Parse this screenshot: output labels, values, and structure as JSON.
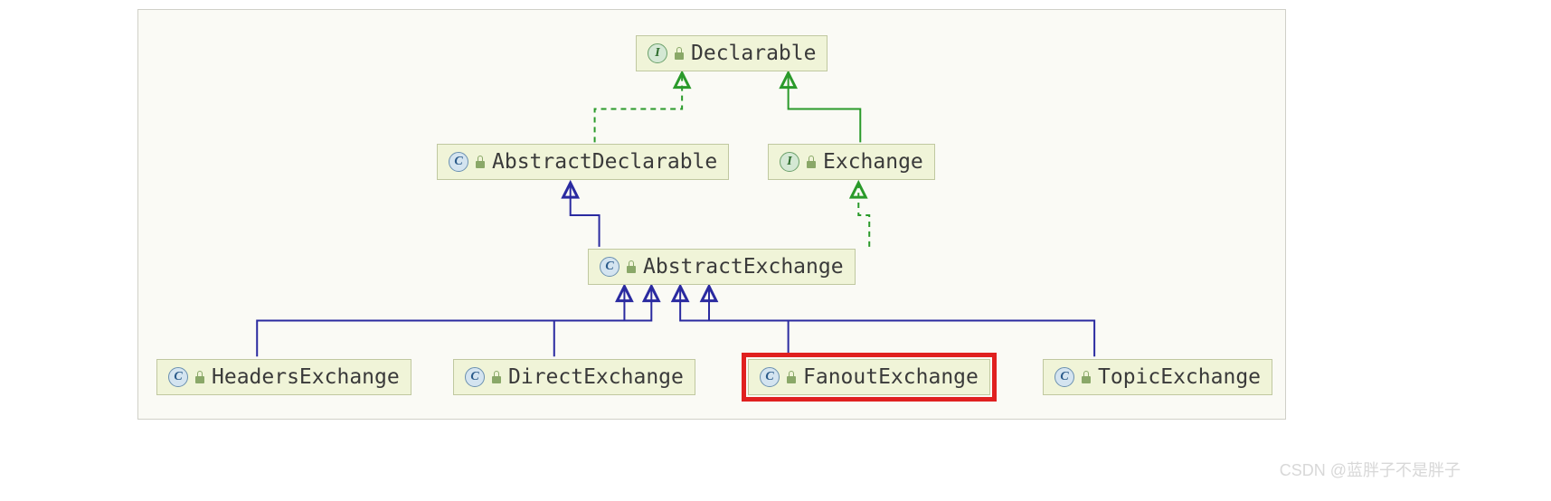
{
  "nodes": {
    "declarable": {
      "label": "Declarable",
      "type": "interface"
    },
    "abstractDeclarable": {
      "label": "AbstractDeclarable",
      "type": "class"
    },
    "exchange": {
      "label": "Exchange",
      "type": "interface"
    },
    "abstractExchange": {
      "label": "AbstractExchange",
      "type": "class"
    },
    "headersExchange": {
      "label": "HeadersExchange",
      "type": "class"
    },
    "directExchange": {
      "label": "DirectExchange",
      "type": "class"
    },
    "fanoutExchange": {
      "label": "FanoutExchange",
      "type": "class"
    },
    "topicExchange": {
      "label": "TopicExchange",
      "type": "class"
    }
  },
  "highlighted": "fanoutExchange",
  "hierarchy": {
    "root": "Declarable",
    "implements": [
      {
        "from": "AbstractDeclarable",
        "to": "Declarable"
      },
      {
        "from": "Exchange",
        "to": "Declarable"
      },
      {
        "from": "AbstractExchange",
        "to": "Exchange"
      }
    ],
    "extends": [
      {
        "from": "AbstractExchange",
        "to": "AbstractDeclarable"
      },
      {
        "from": "HeadersExchange",
        "to": "AbstractExchange"
      },
      {
        "from": "DirectExchange",
        "to": "AbstractExchange"
      },
      {
        "from": "FanoutExchange",
        "to": "AbstractExchange"
      },
      {
        "from": "TopicExchange",
        "to": "AbstractExchange"
      }
    ]
  },
  "watermark": "CSDN @蓝胖子不是胖子"
}
